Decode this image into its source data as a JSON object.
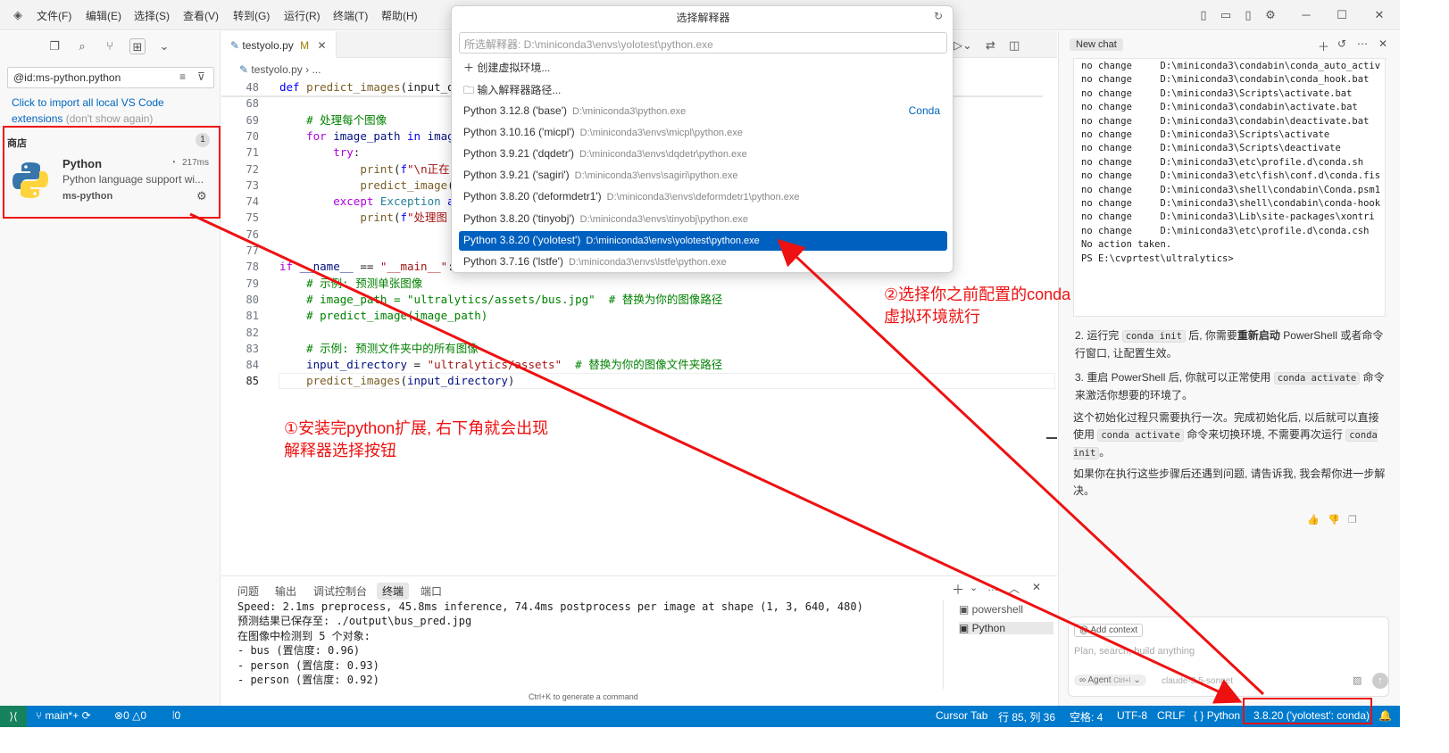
{
  "titlebar": {
    "menus": [
      "文件(F)",
      "编辑(E)",
      "选择(S)",
      "查看(V)",
      "转到(G)",
      "运行(R)",
      "终端(T)",
      "帮助(H)"
    ]
  },
  "sidebar": {
    "filter_value": "@id:ms-python.python",
    "import_link": "Click to import all local VS Code extensions",
    "import_dismiss": "(don't show again)",
    "section_title": "商店",
    "section_count": "1",
    "extension": {
      "name": "Python",
      "time": "217ms",
      "description": "Python language support wi...",
      "publisher": "ms-python"
    }
  },
  "editor": {
    "tab_label": "testyolo.py",
    "tab_modified": "M",
    "breadcrumb": "testyolo.py",
    "breadcrumb_more": "...",
    "line_numbers": [
      "48",
      "68",
      "69",
      "70",
      "71",
      "72",
      "73",
      "74",
      "75",
      "76",
      "77",
      "78",
      "79",
      "80",
      "81",
      "82",
      "83",
      "84",
      "85"
    ],
    "lines": [
      {
        "indent": "",
        "parts": [
          [
            "k",
            "def "
          ],
          [
            "f",
            "predict_images"
          ],
          [
            "",
            "(input_d"
          ]
        ]
      },
      {
        "indent": "",
        "parts": []
      },
      {
        "indent": "    ",
        "parts": [
          [
            "c",
            "# 处理每个图像"
          ]
        ]
      },
      {
        "indent": "    ",
        "parts": [
          [
            "kc",
            "for "
          ],
          [
            "v",
            "image_path "
          ],
          [
            "k",
            "in "
          ],
          [
            "v",
            "imag"
          ]
        ]
      },
      {
        "indent": "        ",
        "parts": [
          [
            "kc",
            "try"
          ],
          [
            "",
            ":"
          ]
        ]
      },
      {
        "indent": "            ",
        "parts": [
          [
            "f",
            "print"
          ],
          [
            "",
            "("
          ],
          [
            "k",
            "f"
          ],
          [
            "s",
            "\"\\n正在"
          ]
        ]
      },
      {
        "indent": "            ",
        "parts": [
          [
            "f",
            "predict_image"
          ],
          [
            "",
            "("
          ]
        ]
      },
      {
        "indent": "        ",
        "parts": [
          [
            "kc",
            "except "
          ],
          [
            "t",
            "Exception "
          ],
          [
            "k",
            "a"
          ]
        ]
      },
      {
        "indent": "            ",
        "parts": [
          [
            "f",
            "print"
          ],
          [
            "",
            "("
          ],
          [
            "k",
            "f"
          ],
          [
            "s",
            "\"处理图"
          ]
        ]
      },
      {
        "indent": "",
        "parts": []
      },
      {
        "indent": "",
        "parts": []
      },
      {
        "indent": "",
        "parts": [
          [
            "kc",
            "if "
          ],
          [
            "v",
            "__name__"
          ],
          [
            "",
            " == "
          ],
          [
            "s",
            "\"__main__\""
          ],
          [
            "",
            ":"
          ]
        ]
      },
      {
        "indent": "    ",
        "parts": [
          [
            "c",
            "# 示例: 预测单张图像"
          ]
        ]
      },
      {
        "indent": "    ",
        "parts": [
          [
            "c",
            "# image_path = \"ultralytics/assets/bus.jpg\"  # 替换为你的图像路径"
          ]
        ]
      },
      {
        "indent": "    ",
        "parts": [
          [
            "c",
            "# predict_image(image_path)"
          ]
        ]
      },
      {
        "indent": "",
        "parts": []
      },
      {
        "indent": "    ",
        "parts": [
          [
            "c",
            "# 示例: 预测文件夹中的所有图像"
          ]
        ]
      },
      {
        "indent": "    ",
        "parts": [
          [
            "v",
            "input_directory"
          ],
          [
            "",
            " = "
          ],
          [
            "s",
            "\"ultralytics/assets\""
          ],
          [
            "c",
            "  # 替换为你的图像文件夹路径"
          ]
        ]
      },
      {
        "indent": "    ",
        "parts": [
          [
            "f",
            "predict_images"
          ],
          [
            "",
            "("
          ],
          [
            "v",
            "input_directory"
          ],
          [
            "",
            ")"
          ]
        ]
      }
    ]
  },
  "panel": {
    "tabs": [
      "问题",
      "输出",
      "调试控制台",
      "终端",
      "端口"
    ],
    "active_tab": "终端",
    "terminal_lines": [
      "Speed: 2.1ms preprocess, 45.8ms inference, 74.4ms postprocess per image at shape (1, 3, 640, 480)",
      "预测结果已保存至: ./output\\bus_pred.jpg",
      "在图像中检测到 5 个对象:",
      "- bus (置信度: 0.96)",
      "- person (置信度: 0.93)",
      "- person (置信度: 0.92)"
    ],
    "hint": "Ctrl+K to generate a command",
    "terminal_list": [
      "powershell",
      "Python"
    ]
  },
  "picker": {
    "title": "选择解释器",
    "input_value": "所选解释器: D:\\miniconda3\\envs\\yolotest\\python.exe",
    "create_env": "创建虚拟环境...",
    "enter_path": "输入解释器路径...",
    "items": [
      {
        "name": "Python 3.12.8 ('base')",
        "path": "D:\\miniconda3\\python.exe",
        "tag": "Conda"
      },
      {
        "name": "Python 3.10.16 ('micpl')",
        "path": "D:\\miniconda3\\envs\\micpl\\python.exe",
        "tag": ""
      },
      {
        "name": "Python 3.9.21 ('dqdetr')",
        "path": "D:\\miniconda3\\envs\\dqdetr\\python.exe",
        "tag": ""
      },
      {
        "name": "Python 3.9.21 ('sagiri')",
        "path": "D:\\miniconda3\\envs\\sagiri\\python.exe",
        "tag": ""
      },
      {
        "name": "Python 3.8.20 ('deformdetr1')",
        "path": "D:\\miniconda3\\envs\\deformdetr1\\python.exe",
        "tag": ""
      },
      {
        "name": "Python 3.8.20 ('tinyobj')",
        "path": "D:\\miniconda3\\envs\\tinyobj\\python.exe",
        "tag": ""
      },
      {
        "name": "Python 3.8.20 ('yolotest')",
        "path": "D:\\miniconda3\\envs\\yolotest\\python.exe",
        "tag": ""
      },
      {
        "name": "Python 3.7.16 ('lstfe')",
        "path": "D:\\miniconda3\\envs\\lstfe\\python.exe",
        "tag": ""
      }
    ],
    "selected_index": 6
  },
  "chat": {
    "tab_label": "New chat",
    "code_lines": [
      "no change     D:\\miniconda3\\condabin\\conda_auto_activ",
      "no change     D:\\miniconda3\\condabin\\conda_hook.bat",
      "no change     D:\\miniconda3\\Scripts\\activate.bat",
      "no change     D:\\miniconda3\\condabin\\activate.bat",
      "no change     D:\\miniconda3\\condabin\\deactivate.bat",
      "no change     D:\\miniconda3\\Scripts\\activate",
      "no change     D:\\miniconda3\\Scripts\\deactivate",
      "no change     D:\\miniconda3\\etc\\profile.d\\conda.sh",
      "no change     D:\\miniconda3\\etc\\fish\\conf.d\\conda.fis",
      "no change     D:\\miniconda3\\shell\\condabin\\Conda.psm1",
      "no change     D:\\miniconda3\\shell\\condabin\\conda-hook",
      "no change     D:\\miniconda3\\Lib\\site-packages\\xontri",
      "no change     D:\\miniconda3\\etc\\profile.d\\conda.csh",
      "No action taken.",
      "PS E:\\cvprtest\\ultralytics>"
    ],
    "step2_a": "2. 运行完",
    "step2_code": "conda init",
    "step2_b": "后, 你需要",
    "step2_bold": "重新启动",
    "step2_c": "PowerShell 或者命令行窗口, 让配置生效。",
    "step3_a": "3. 重启 PowerShell 后, 你就可以正常使用",
    "step3_code": "conda activate",
    "step3_b": "命令来激活你想要的环境了。",
    "para1_a": "这个初始化过程只需要执行一次。完成初始化后, 以后就可以直接使用",
    "para1_code": "conda activate",
    "para1_b": "命令来切换环境, 不需要再次运行",
    "para1_code2": "conda init",
    "para1_c": "。",
    "para2": "如果你在执行这些步骤后还遇到问题, 请告诉我, 我会帮你进一步解决。",
    "add_context": "Add context",
    "input_placeholder": "Plan, search, build anything",
    "agent_label": "Agent",
    "agent_shortcut": "Ctrl+I",
    "model": "claude-3.5-sonnet"
  },
  "statusbar": {
    "branch": "main*+",
    "errors": "0",
    "warnings": "0",
    "ports": "0",
    "cursor_tab": "Cursor Tab",
    "position": "行 85, 列 36",
    "spaces": "空格: 4",
    "encoding": "UTF-8",
    "eol": "CRLF",
    "language": "Python",
    "interpreter": "3.8.20 ('yolotest': conda)"
  },
  "annotations": {
    "note1_line1": "①安装完python扩展, 右下角就会出现",
    "note1_line2": "解释器选择按钮",
    "note2_line1": "②选择你之前配置的conda",
    "note2_line2": "虚拟环境就行"
  },
  "colors": {
    "statusbar": "#007acc",
    "selection": "#0060c0",
    "annotation": "#ee1111"
  }
}
